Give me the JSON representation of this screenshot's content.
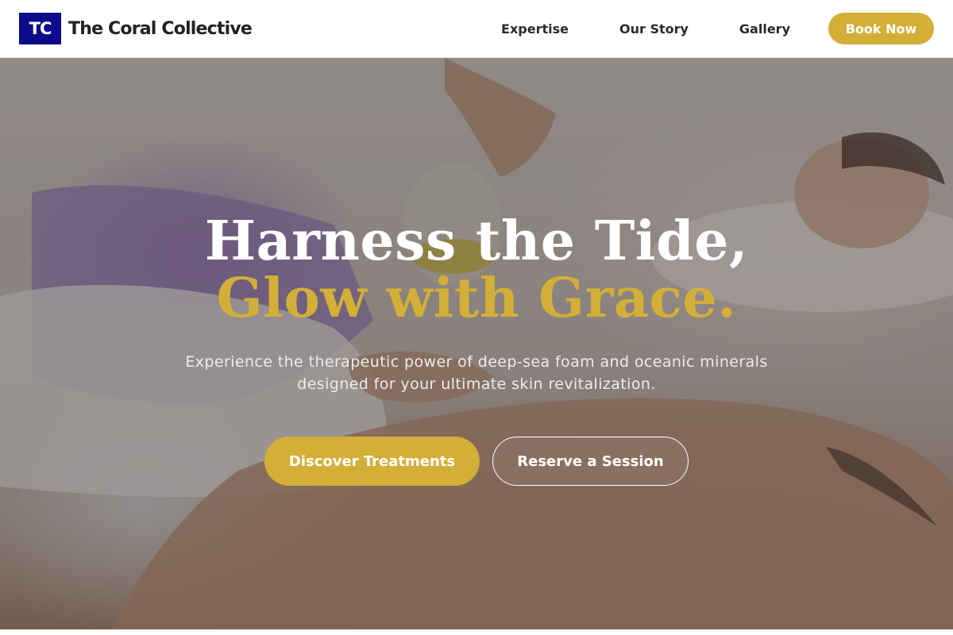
{
  "header": {
    "logo_initials": "TC",
    "brand_name": "The Coral Collective",
    "nav": [
      "Expertise",
      "Our Story",
      "Gallery"
    ],
    "book_label": "Book Now"
  },
  "hero": {
    "headline_line1": "Harness the Tide,",
    "headline_line2": "Glow with Grace.",
    "subtext": "Experience the therapeutic power of deep-sea foam and oceanic minerals designed for your ultimate skin revitalization.",
    "primary_cta": "Discover Treatments",
    "secondary_cta": "Reserve a Session",
    "background_image": "massage-oil-pouring-photo"
  },
  "colors": {
    "brand_navy": "#0c0c8a",
    "accent_gold": "#d4af37",
    "nav_text": "#2a2a2a"
  }
}
